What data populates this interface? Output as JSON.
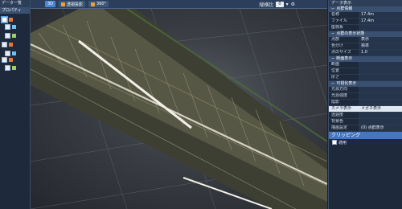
{
  "left_panel": {
    "title": "データ一覧",
    "subtitle": "プロパティ"
  },
  "toolbar": {
    "btn_3d": "3D",
    "btn_view": "透視投影",
    "btn_360": "360°",
    "zoom_label": "縦横比",
    "zoom_value": "0"
  },
  "right_panel": {
    "title": "データ表示",
    "sections": [
      {
        "label": "点群情報",
        "rows": [
          {
            "k": "名称",
            "v": "17.4m"
          },
          {
            "k": "ファイル",
            "v": "17.4m"
          },
          {
            "k": "座標系",
            "v": ""
          }
        ]
      },
      {
        "label": "点群の表示状態",
        "rows": [
          {
            "k": "点群",
            "v": "表示"
          },
          {
            "k": "色分け",
            "v": "標準"
          },
          {
            "k": "点のサイズ",
            "v": "1.0"
          }
        ]
      },
      {
        "label": "断面表示",
        "rows": [
          {
            "k": "断面",
            "v": ""
          },
          {
            "k": "位置",
            "v": ""
          },
          {
            "k": "厚さ",
            "v": ""
          }
        ]
      },
      {
        "label": "可視化表示",
        "rows": [
          {
            "k": "光源方向",
            "v": ""
          },
          {
            "k": "光源強度",
            "v": ""
          },
          {
            "k": "陰影",
            "v": ""
          },
          {
            "k": "カメラ表示",
            "v": "メガネ表示",
            "hl": true
          },
          {
            "k": "透過度",
            "v": ""
          },
          {
            "k": "背景色",
            "v": ""
          },
          {
            "k": "描画設定",
            "v": "(0) 点群表示"
          }
        ]
      }
    ]
  },
  "clipping": {
    "title": "クリッピング",
    "item": "適用"
  }
}
